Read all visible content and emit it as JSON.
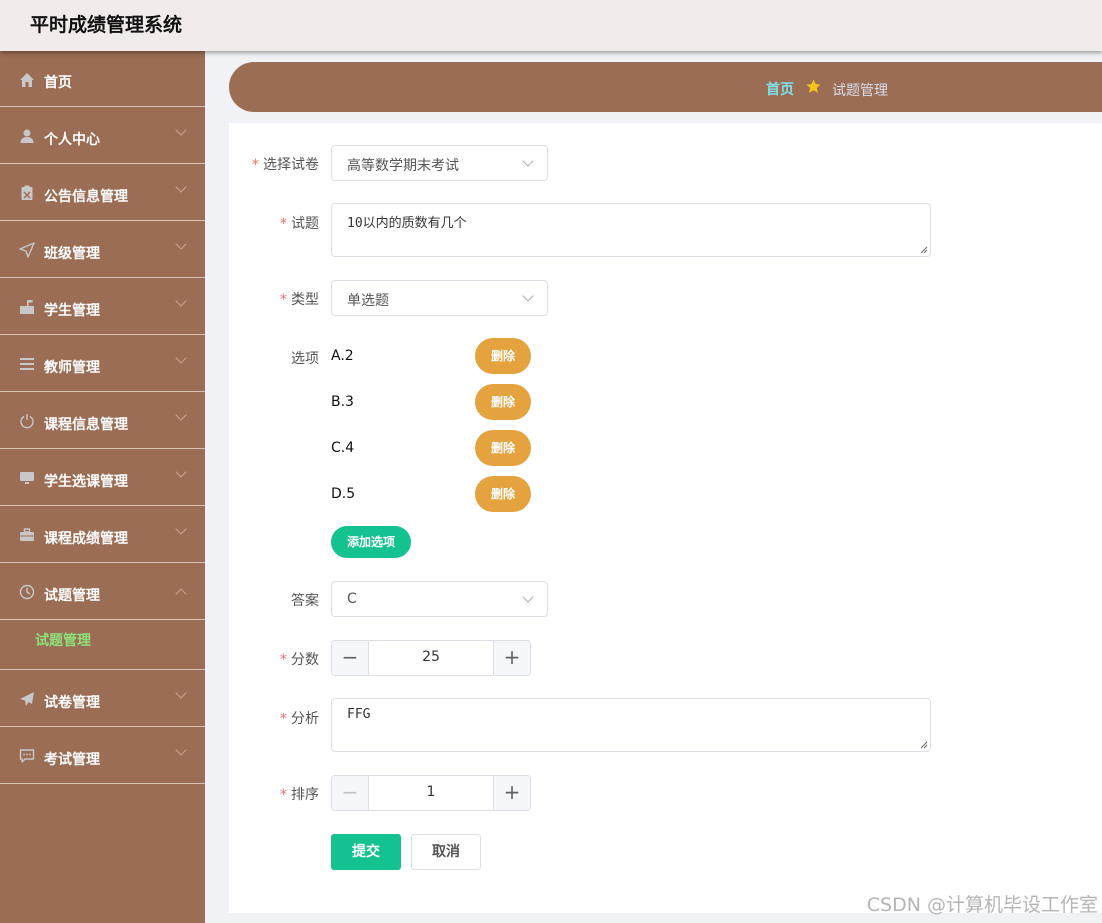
{
  "app": {
    "title": "平时成绩管理系统"
  },
  "sidebar": {
    "items": [
      {
        "label": "首页",
        "icon": "home-icon"
      },
      {
        "label": "个人中心",
        "icon": "user-icon"
      },
      {
        "label": "公告信息管理",
        "icon": "clipboard-icon"
      },
      {
        "label": "班级管理",
        "icon": "send-icon"
      },
      {
        "label": "学生管理",
        "icon": "mailbox-icon"
      },
      {
        "label": "教师管理",
        "icon": "list-icon"
      },
      {
        "label": "课程信息管理",
        "icon": "power-icon"
      },
      {
        "label": "学生选课管理",
        "icon": "monitor-icon"
      },
      {
        "label": "课程成绩管理",
        "icon": "briefcase-icon"
      },
      {
        "label": "试题管理",
        "icon": "clock-icon",
        "expanded": true,
        "children": [
          {
            "label": "试题管理"
          }
        ]
      },
      {
        "label": "试卷管理",
        "icon": "paper-plane-icon"
      },
      {
        "label": "考试管理",
        "icon": "chat-icon"
      }
    ]
  },
  "breadcrumb": {
    "home": "首页",
    "current": "试题管理"
  },
  "form": {
    "paper": {
      "label": "选择试卷",
      "value": "高等数学期末考试"
    },
    "question": {
      "label": "试题",
      "value": "10以内的质数有几个"
    },
    "type": {
      "label": "类型",
      "value": "单选题"
    },
    "options": {
      "label": "选项",
      "items": [
        "A.2",
        "B.3",
        "C.4",
        "D.5"
      ],
      "delete_label": "删除",
      "add_label": "添加选项"
    },
    "answer": {
      "label": "答案",
      "value": "C"
    },
    "score": {
      "label": "分数",
      "value": "25"
    },
    "analysis": {
      "label": "分析",
      "value": "FFG"
    },
    "sort": {
      "label": "排序",
      "value": "1"
    },
    "submit_label": "提交",
    "cancel_label": "取消"
  },
  "watermark": "CSDN @计算机毕设工作室",
  "colors": {
    "sidebar_bg": "#9b6d55",
    "accent_green": "#13c28f",
    "delete_orange": "#e4a33f",
    "submenu_active": "#8ee07a",
    "breadcrumb_home": "#7fe0ea"
  }
}
